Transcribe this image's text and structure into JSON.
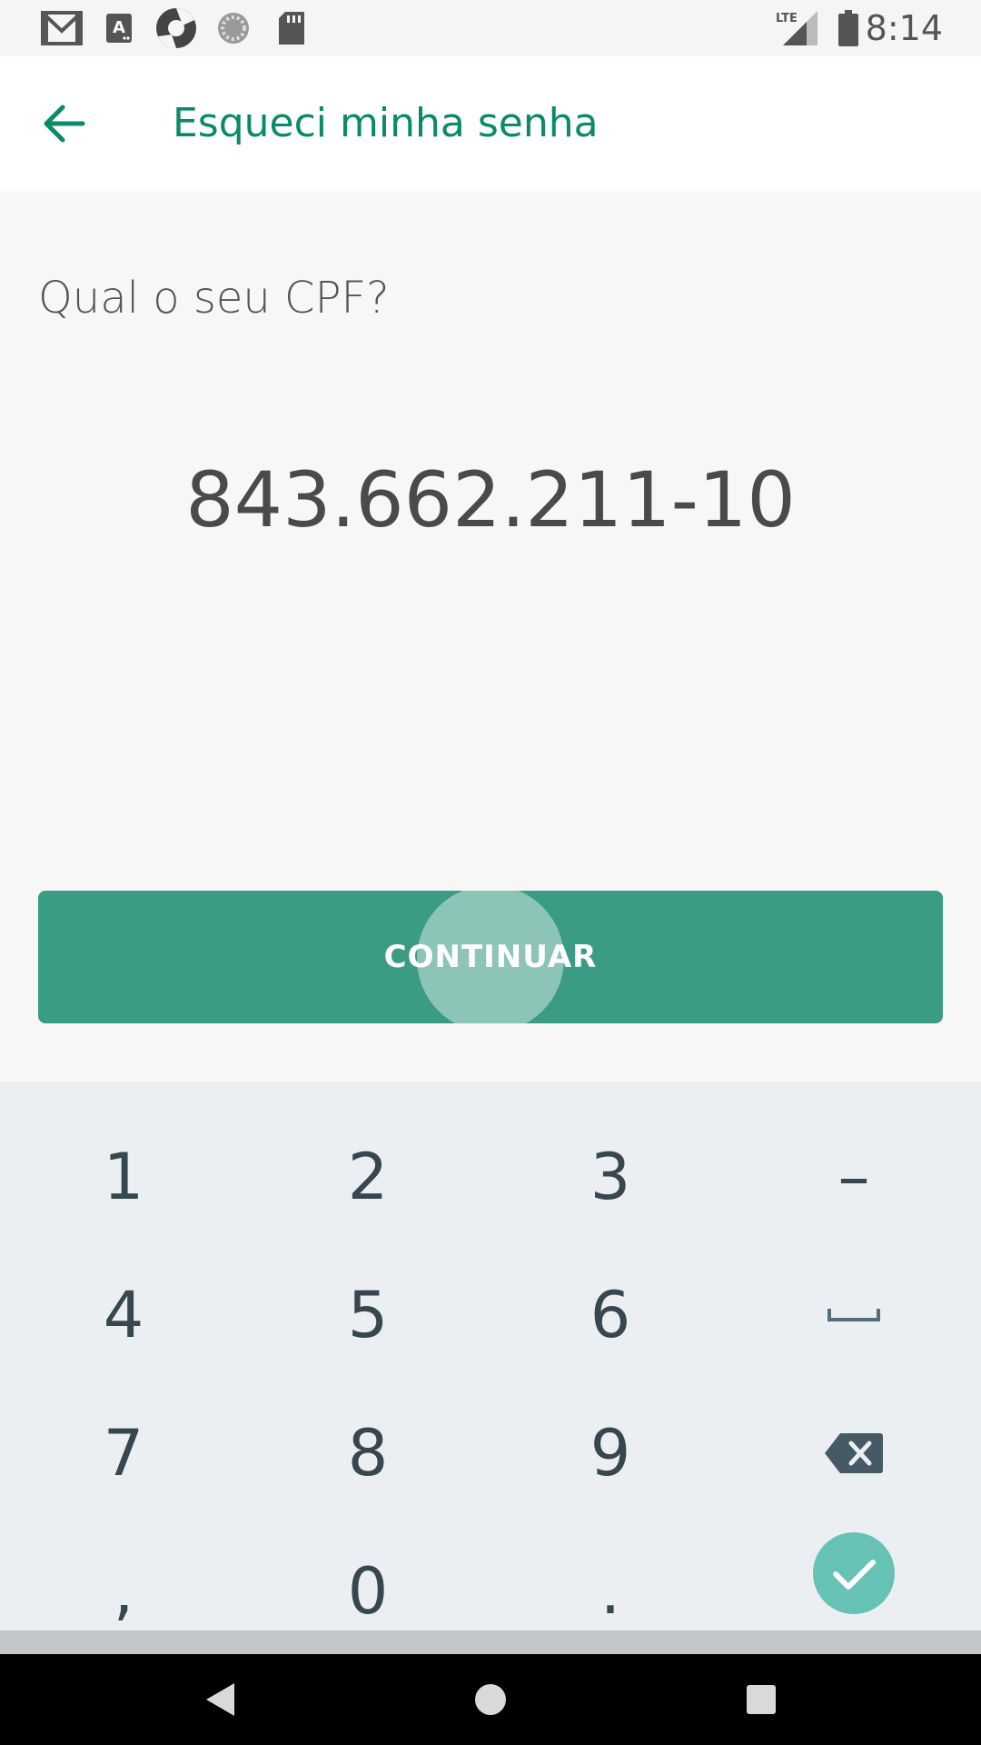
{
  "status_bar": {
    "time": "8:14",
    "network": "LTE",
    "icons": [
      "gmail-icon",
      "app-a-icon",
      "shutter-app-icon",
      "sync-icon",
      "sd-card-icon",
      "lte-signal-icon",
      "battery-icon"
    ]
  },
  "app_bar": {
    "title": "Esqueci minha senha",
    "back_icon": "arrow-left-icon",
    "accent_color": "#0a8a68"
  },
  "form": {
    "question": "Qual o seu CPF?",
    "cpf_value": "843.662.211-10"
  },
  "continue_button": {
    "label": "CONTINUAR",
    "color": "#3a9c84"
  },
  "keyboard": {
    "rows": [
      [
        "1",
        "2",
        "3",
        "–"
      ],
      [
        "4",
        "5",
        "6",
        "space-icon"
      ],
      [
        "7",
        "8",
        "9",
        "backspace-icon"
      ],
      [
        ",",
        "0",
        ".",
        "check-icon"
      ]
    ],
    "done_color": "#66c2b4"
  },
  "nav_bar": {
    "buttons": [
      "back-triangle-icon",
      "home-circle-icon",
      "recents-square-icon"
    ]
  }
}
